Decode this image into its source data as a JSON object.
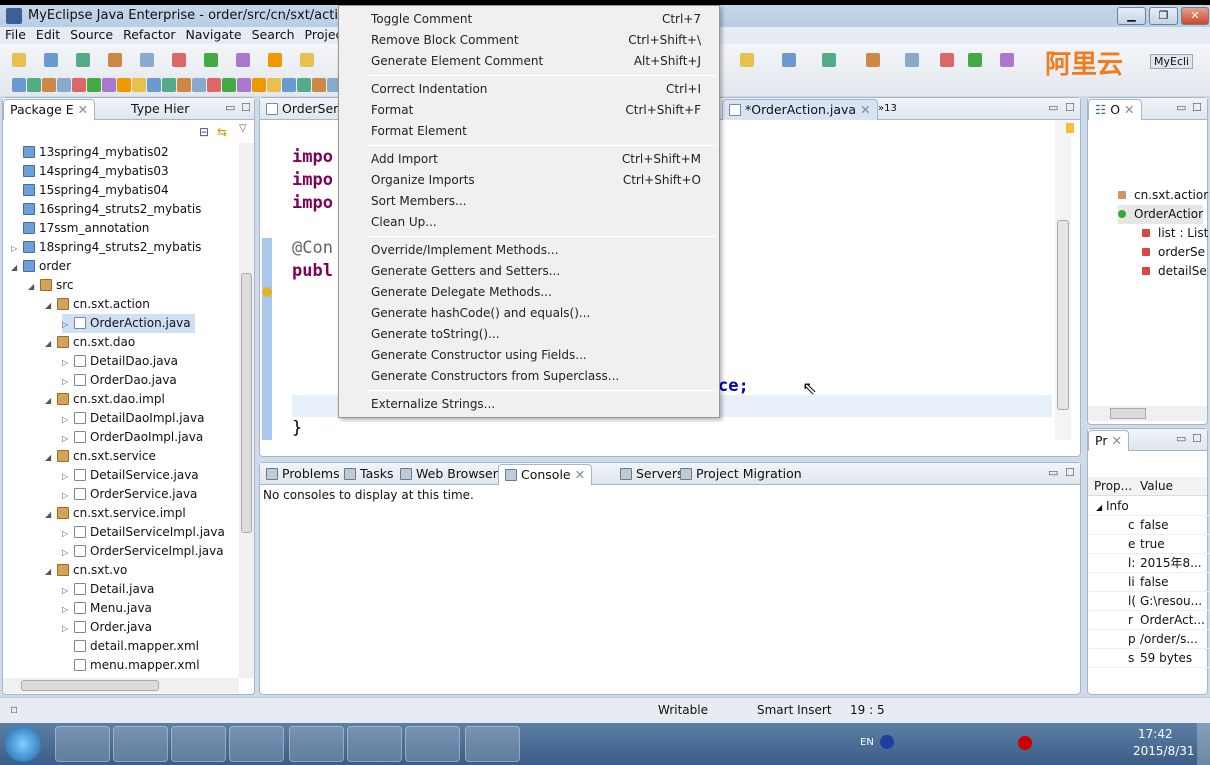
{
  "window": {
    "title": "MyEclipse Java Enterprise - order/src/cn/sxt/action/Orde",
    "minimize": "▁",
    "restore": "❐",
    "close": "✕"
  },
  "menubar": [
    "File",
    "Edit",
    "Source",
    "Refactor",
    "Navigate",
    "Search",
    "Project"
  ],
  "watermark": "阿里云",
  "perspective": "MyEcli",
  "left_panel": {
    "tabs": [
      "Package E",
      "Type Hier"
    ],
    "tree": [
      {
        "label": "13spring4_mybatis02",
        "level": 0,
        "icon": "project",
        "arrow": ""
      },
      {
        "label": "14spring4_mybatis03",
        "level": 0,
        "icon": "project",
        "arrow": ""
      },
      {
        "label": "15spring4_mybatis04",
        "level": 0,
        "icon": "project",
        "arrow": ""
      },
      {
        "label": "16spring4_struts2_mybatis",
        "level": 0,
        "icon": "project",
        "arrow": ""
      },
      {
        "label": "17ssm_annotation",
        "level": 0,
        "icon": "project",
        "arrow": ""
      },
      {
        "label": "18spring4_struts2_mybatis",
        "level": 0,
        "icon": "project",
        "arrow": "▷"
      },
      {
        "label": "order",
        "level": 0,
        "icon": "project",
        "arrow": "◢"
      },
      {
        "label": "src",
        "level": 1,
        "icon": "package",
        "arrow": "◢"
      },
      {
        "label": "cn.sxt.action",
        "level": 2,
        "icon": "package",
        "arrow": "◢"
      },
      {
        "label": "OrderAction.java",
        "level": 3,
        "icon": "java",
        "arrow": "▷",
        "selected": true
      },
      {
        "label": "cn.sxt.dao",
        "level": 2,
        "icon": "package",
        "arrow": "◢"
      },
      {
        "label": "DetailDao.java",
        "level": 3,
        "icon": "java",
        "arrow": "▷"
      },
      {
        "label": "OrderDao.java",
        "level": 3,
        "icon": "java",
        "arrow": "▷"
      },
      {
        "label": "cn.sxt.dao.impl",
        "level": 2,
        "icon": "package",
        "arrow": "◢"
      },
      {
        "label": "DetailDaoImpl.java",
        "level": 3,
        "icon": "java",
        "arrow": "▷"
      },
      {
        "label": "OrderDaoImpl.java",
        "level": 3,
        "icon": "java",
        "arrow": "▷"
      },
      {
        "label": "cn.sxt.service",
        "level": 2,
        "icon": "package",
        "arrow": "◢"
      },
      {
        "label": "DetailService.java",
        "level": 3,
        "icon": "java",
        "arrow": "▷"
      },
      {
        "label": "OrderService.java",
        "level": 3,
        "icon": "java",
        "arrow": "▷"
      },
      {
        "label": "cn.sxt.service.impl",
        "level": 2,
        "icon": "package",
        "arrow": "◢"
      },
      {
        "label": "DetailServiceImpl.java",
        "level": 3,
        "icon": "java",
        "arrow": "▷"
      },
      {
        "label": "OrderServiceImpl.java",
        "level": 3,
        "icon": "java",
        "arrow": "▷"
      },
      {
        "label": "cn.sxt.vo",
        "level": 2,
        "icon": "package",
        "arrow": "◢"
      },
      {
        "label": "Detail.java",
        "level": 3,
        "icon": "java",
        "arrow": "▷"
      },
      {
        "label": "Menu.java",
        "level": 3,
        "icon": "java",
        "arrow": "▷"
      },
      {
        "label": "Order.java",
        "level": 3,
        "icon": "java",
        "arrow": "▷"
      },
      {
        "label": "detail.mapper.xml",
        "level": 3,
        "icon": "xml",
        "arrow": ""
      },
      {
        "label": "menu.mapper.xml",
        "level": 3,
        "icon": "xml",
        "arrow": ""
      }
    ]
  },
  "editor": {
    "tabs": [
      "OrderServ",
      "*OrderAction.java"
    ],
    "overflow": "»13",
    "code": [
      "impo",
      "impo",
      "impo",
      "@Con",
      "publ",
      "ce;",
      "}"
    ]
  },
  "context_menu": [
    {
      "label": "Toggle Comment",
      "shortcut": "Ctrl+7"
    },
    {
      "label": "Remove Block Comment",
      "shortcut": "Ctrl+Shift+\\"
    },
    {
      "label": "Generate Element Comment",
      "shortcut": "Alt+Shift+J"
    },
    {
      "sep": true
    },
    {
      "label": "Correct Indentation",
      "shortcut": "Ctrl+I"
    },
    {
      "label": "Format",
      "shortcut": "Ctrl+Shift+F"
    },
    {
      "label": "Format Element",
      "shortcut": ""
    },
    {
      "sep": true
    },
    {
      "label": "Add Import",
      "shortcut": "Ctrl+Shift+M"
    },
    {
      "label": "Organize Imports",
      "shortcut": "Ctrl+Shift+O"
    },
    {
      "label": "Sort Members...",
      "shortcut": ""
    },
    {
      "label": "Clean Up...",
      "shortcut": ""
    },
    {
      "sep": true
    },
    {
      "label": "Override/Implement Methods...",
      "shortcut": ""
    },
    {
      "label": "Generate Getters and Setters...",
      "shortcut": ""
    },
    {
      "label": "Generate Delegate Methods...",
      "shortcut": ""
    },
    {
      "label": "Generate hashCode() and equals()...",
      "shortcut": ""
    },
    {
      "label": "Generate toString()...",
      "shortcut": ""
    },
    {
      "label": "Generate Constructor using Fields...",
      "shortcut": ""
    },
    {
      "label": "Generate Constructors from Superclass...",
      "shortcut": ""
    },
    {
      "sep": true
    },
    {
      "label": "Externalize Strings...",
      "shortcut": ""
    }
  ],
  "outline": {
    "tab": "O",
    "items": [
      {
        "label": "cn.sxt.actior",
        "level": 0,
        "icon": "package"
      },
      {
        "label": "OrderActior",
        "level": 0,
        "icon": "class"
      },
      {
        "label": "list : List",
        "level": 1,
        "icon": "field"
      },
      {
        "label": "orderSe",
        "level": 1,
        "icon": "field"
      },
      {
        "label": "detailSe",
        "level": 1,
        "icon": "field"
      }
    ]
  },
  "console": {
    "tabs": [
      "Problems",
      "Tasks",
      "Web Browser",
      "Console",
      "Servers",
      "Project Migration"
    ],
    "active": "Console",
    "message": "No consoles to display at this time."
  },
  "properties": {
    "tab": "Pr",
    "headers": [
      "Prop...",
      "Value"
    ],
    "group": "Info",
    "rows": [
      [
        "c",
        "false"
      ],
      [
        "e",
        "true"
      ],
      [
        "l:",
        "2015年8..."
      ],
      [
        "li",
        "false"
      ],
      [
        "l(",
        "G:\\resou..."
      ],
      [
        "r",
        "OrderAct..."
      ],
      [
        "p",
        "/order/s..."
      ],
      [
        "s",
        "59  bytes"
      ]
    ]
  },
  "status": {
    "writable": "Writable",
    "insert_mode": "Smart Insert",
    "position": "19 : 5"
  },
  "taskbar": {
    "lang": "EN",
    "time": "17:42",
    "date": "2015/8/31"
  },
  "colors": {
    "keyword": "#7f0055",
    "selection": "#cfe0f5",
    "menu_bg": "#f0f0f0",
    "watermark": "#f07c1e"
  }
}
